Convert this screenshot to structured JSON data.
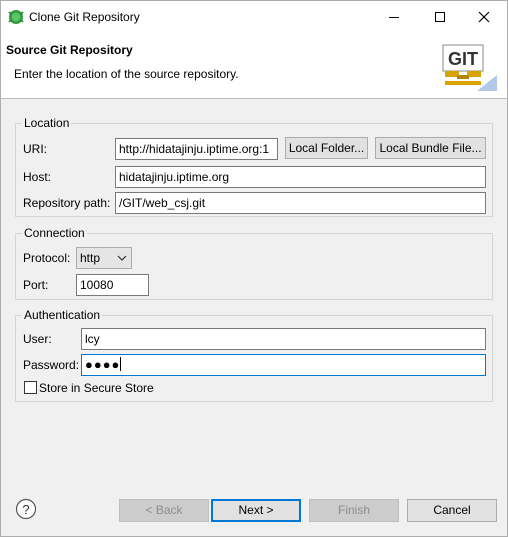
{
  "window": {
    "title": "Clone Git Repository",
    "icon": "eclipse-icon"
  },
  "banner": {
    "title": "Source Git Repository",
    "description": "Enter the location of the source repository.",
    "logo_text": "GIT"
  },
  "location": {
    "group_label": "Location",
    "uri_label": "URI:",
    "uri_value": "http://hidatajinju.iptime.org:1",
    "local_folder_button": "Local Folder...",
    "local_bundle_button": "Local Bundle File...",
    "host_label": "Host:",
    "host_value": "hidatajinju.iptime.org",
    "repo_path_label": "Repository path:",
    "repo_path_value": "/GIT/web_csj.git"
  },
  "connection": {
    "group_label": "Connection",
    "protocol_label": "Protocol:",
    "protocol_value": "http",
    "port_label": "Port:",
    "port_value": "10080"
  },
  "authentication": {
    "group_label": "Authentication",
    "user_label": "User:",
    "user_value": "lcy",
    "password_label": "Password:",
    "password_value": "●●●●",
    "store_label": "Store in Secure Store",
    "store_checked": false
  },
  "footer": {
    "back_button": "< Back",
    "next_button": "Next >",
    "finish_button": "Finish",
    "cancel_button": "Cancel"
  },
  "colors": {
    "focus_border": "#0078d7",
    "eclipse_green": "#2e9a3a",
    "git_gold": "#d9a400"
  }
}
